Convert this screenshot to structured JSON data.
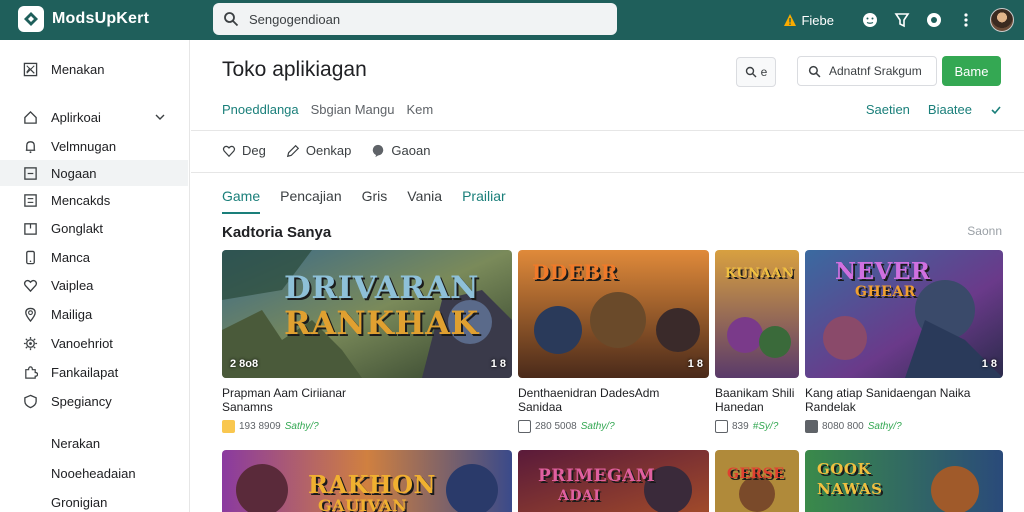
{
  "app": {
    "brand": "ModsUpKert"
  },
  "search": {
    "placeholder": "Sengogendioan"
  },
  "topbar": {
    "warning_label": "Fiebe"
  },
  "sidebar": {
    "items": [
      {
        "label": "Menakan",
        "icon": "image-icon"
      },
      {
        "label": "Aplirkoai",
        "icon": "home-icon",
        "expand": true
      },
      {
        "label": "Velmnugan",
        "icon": "bell-icon"
      },
      {
        "label": "Nogaan",
        "icon": "square-icon",
        "active": true
      },
      {
        "label": "Mencakds",
        "icon": "list-icon"
      },
      {
        "label": "Gonglakt",
        "icon": "box-icon"
      },
      {
        "label": "Manca",
        "icon": "phone-icon"
      },
      {
        "label": "Vaiplea",
        "icon": "heart-icon"
      },
      {
        "label": "Mailiga",
        "icon": "location-icon"
      },
      {
        "label": "Vanoehriot",
        "icon": "gear-icon"
      },
      {
        "label": "Fankailapat",
        "icon": "puzzle-icon"
      },
      {
        "label": "Spegiancy",
        "icon": "shield-icon"
      }
    ],
    "plain_items": [
      "Nerakan",
      "Nooeheadaian",
      "Gronigian"
    ]
  },
  "main": {
    "title": "Toko aplikiagan",
    "small_search_label": "e",
    "filter_placeholder": "Adnatnf Srakgum",
    "primary_button": "Bame",
    "subnav": [
      "Pnoeddlanga",
      "Sbgian Mangu",
      "Kem"
    ],
    "subnav_right": [
      "Saetien",
      "Biaatee"
    ],
    "actions": [
      "Deg",
      "Oenkap",
      "Gaoan"
    ],
    "tabs": [
      "Game",
      "Pencajian",
      "Gris",
      "Vania",
      "Prailiar"
    ],
    "section_title": "Kadtoria Sanya",
    "see_all": "Saonn"
  },
  "cards": [
    {
      "logo_line1": "DRIVARAN",
      "logo_line2": "RANKHAK",
      "rating": "2 8o8",
      "age": "1 8",
      "title_line1": "Prapman Aam Ciriianar",
      "title_line2": "Sanamns",
      "meta_size": "193 8909",
      "meta_price": "Sathy/?"
    },
    {
      "logo_line1": "DDEBR",
      "logo_line2": "",
      "rating": "",
      "age": "1 8",
      "title_line1": "Denthaenidran DadesAdm",
      "title_line2": "Sanidaa",
      "meta_size": "280 5008",
      "meta_price": "Sathy/?"
    },
    {
      "logo_line1": "KUNAAN",
      "logo_line2": "",
      "rating": "",
      "age": "",
      "title_line1": "Baanikam Shili",
      "title_line2": "Hanedan",
      "meta_size": "839",
      "meta_price": "#Sy/?"
    },
    {
      "logo_line1": "NEVER",
      "logo_line2": "GHEAR",
      "rating": "",
      "age": "1 8",
      "title_line1": "Kang atiap Sanidaengan Naika",
      "title_line2": "Randelak",
      "meta_size": "8080 800",
      "meta_price": "Sathy/?"
    },
    {
      "logo_line1": "RAKHON",
      "logo_line2": "GAUIVAN",
      "rating": "",
      "age": "",
      "title_line1": "",
      "title_line2": "",
      "meta_size": "",
      "meta_price": ""
    },
    {
      "logo_line1": "PRIMEGAM",
      "logo_line2": "ADAI",
      "rating": "",
      "age": "",
      "title_line1": "",
      "title_line2": "",
      "meta_size": "",
      "meta_price": ""
    },
    {
      "logo_line1": "GERSE",
      "logo_line2": "",
      "rating": "",
      "age": "",
      "title_line1": "",
      "title_line2": "",
      "meta_size": "",
      "meta_price": ""
    },
    {
      "logo_line1": "GOOK",
      "logo_line2": "NAWAS",
      "rating": "",
      "age": "",
      "title_line1": "",
      "title_line2": "",
      "meta_size": "",
      "meta_price": ""
    }
  ],
  "colors": {
    "topbar": "#1f5f5b",
    "accent": "#1a7f7a",
    "primary": "#34a853"
  }
}
